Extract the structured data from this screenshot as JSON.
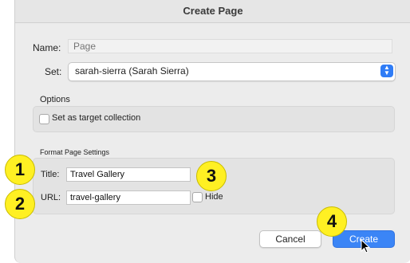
{
  "window": {
    "title": "Create Page"
  },
  "form": {
    "name_label": "Name:",
    "name_placeholder": "Page",
    "set_label": "Set:",
    "set_value": "sarah-sierra (Sarah Sierra)",
    "options_heading": "Options",
    "target_collection_label": "Set as target collection",
    "target_collection_checked": false
  },
  "format_settings": {
    "heading": "Format Page Settings",
    "title_label": "Title:",
    "title_value": "Travel Gallery",
    "url_label": "URL:",
    "url_value": "travel-gallery",
    "hide_label": "Hide",
    "hide_checked": false
  },
  "buttons": {
    "cancel": "Cancel",
    "create": "Create"
  },
  "callouts": [
    "1",
    "2",
    "3",
    "4"
  ],
  "colors": {
    "accent": "#3b85f6",
    "callout": "#fff023"
  },
  "icons": {
    "stepper": "up-down-stepper-icon",
    "cursor": "mouse-pointer-icon"
  }
}
